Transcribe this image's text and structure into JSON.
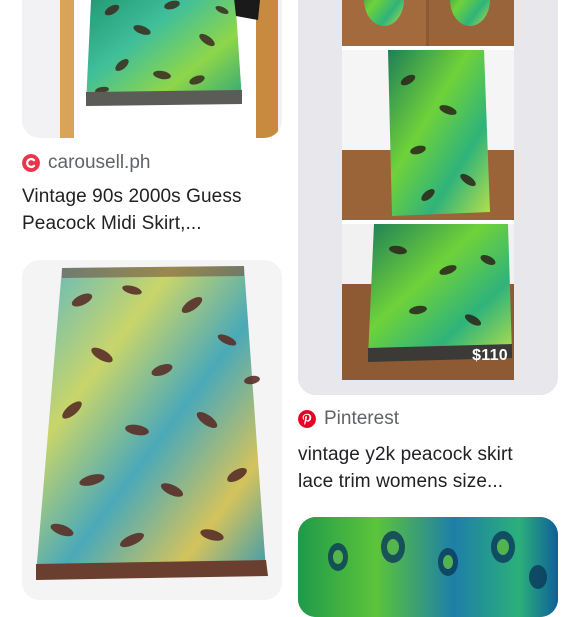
{
  "results": [
    {
      "source": "carousell.ph",
      "title_line1": "Vintage 90s 2000s Guess",
      "title_line2": "Peacock Midi Skirt,..."
    },
    {
      "source": "Pinterest",
      "title_line1": "vintage y2k peacock skirt",
      "title_line2": "lace trim womens size...",
      "price": "$110"
    }
  ],
  "colors": {
    "carousell": "#e8374b",
    "pinterest": "#e60023",
    "text_primary": "#202124",
    "text_secondary": "#5f6368"
  },
  "icons": [
    "carousell-logo-icon",
    "pinterest-logo-icon"
  ]
}
